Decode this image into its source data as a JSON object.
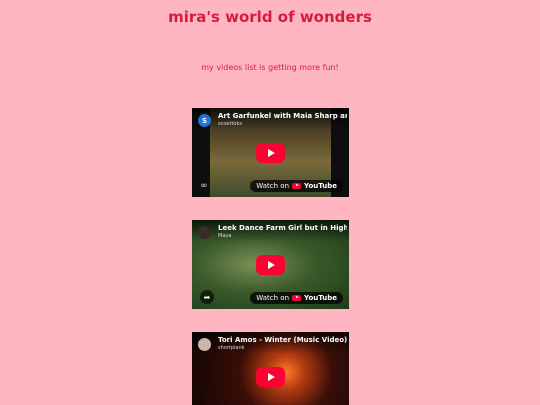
{
  "header": {
    "title": "mira's world of wonders",
    "subtitle": "my videos list is getting more fun!"
  },
  "videos": [
    {
      "title": "Art Garfunkel with Maia Sharp and B",
      "channel": "scoettoks",
      "avatar_letter": "S",
      "avatar_color": "#1976d2",
      "watch_label": "Watch on",
      "brand_label": "YouTube",
      "corner_icon": "link-icon"
    },
    {
      "title": "Leek Dance Farm Girl but in Higher C",
      "channel": "Maya",
      "avatar_letter": "",
      "avatar_color": "#3a2a2a",
      "watch_label": "Watch on",
      "brand_label": "YouTube",
      "corner_icon": "share-icon"
    },
    {
      "title": "Tori Amos - Winter (Music Video)",
      "channel": "shortplank",
      "avatar_letter": "",
      "avatar_color": "#c9b8a8",
      "watch_label": "",
      "brand_label": "",
      "corner_icon": ""
    }
  ]
}
